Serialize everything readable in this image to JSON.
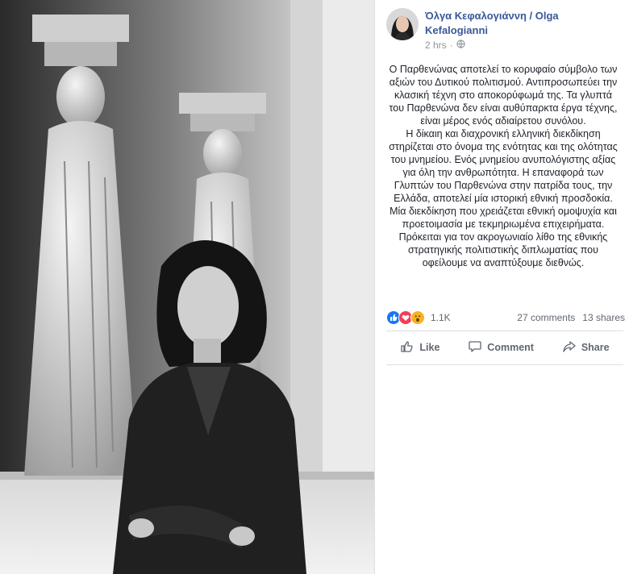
{
  "post": {
    "author": "Όλγα Κεφαλογιάννη / Olga Kefalogianni",
    "time": "2 hrs",
    "privacy_icon": "globe-icon",
    "paragraphs": [
      "Ο Παρθενώνας αποτελεί το κορυφαίο σύμβολο των αξιών του Δυτικού πολιτισμού. Αντιπροσωπεύει την κλασική τέχνη στο αποκορύφωμά της. Τα γλυπτά του Παρθενώνα δεν είναι αυθύπαρκτα έργα τέχνης, είναι μέρος ενός αδιαίρετου συνόλου.",
      "Η δίκαιη και διαχρονική ελληνική διεκδίκηση στηρίζεται στο όνομα της ενότητας και της ολότητας του μνημείου. Ενός μνημείου ανυπολόγιστης αξίας για όλη την ανθρωπότητα. Η επαναφορά των Γλυπτών του Παρθενώνα στην πατρίδα τους, την Ελλάδα, αποτελεί μία ιστορική εθνική προσδοκία.",
      "Μία διεκδίκηση που χρειάζεται εθνική ομοψυχία και προετοιμασία με τεκμηριωμένα επιχειρήματα.",
      "Πρόκειται για τον ακρογωνιαίο λίθο της εθνικής στρατηγικής πολιτιστικής διπλωματίας που οφείλουμε να αναπτύξουμε διεθνώς."
    ]
  },
  "stats": {
    "reaction_count": "1.1K",
    "comments": "27 comments",
    "shares": "13 shares",
    "reactions": [
      "like",
      "love",
      "wow"
    ]
  },
  "actions": {
    "like": "Like",
    "comment": "Comment",
    "share": "Share"
  },
  "colors": {
    "link": "#385898",
    "like_blue": "#1877f2",
    "love_red": "#f33e58",
    "wow_yellow": "#f7b125"
  }
}
